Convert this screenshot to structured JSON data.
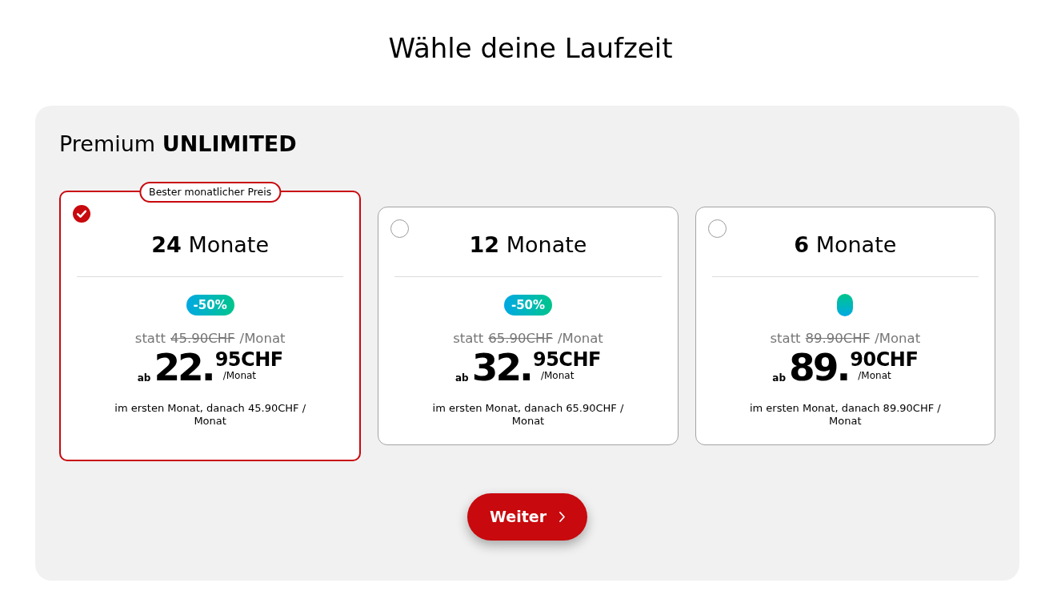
{
  "page": {
    "title": "Wähle deine Laufzeit"
  },
  "product": {
    "name": "Premium **UNLIMITED**"
  },
  "plans": [
    {
      "selected": true,
      "highlight": "Bester monatlicher Preis",
      "title": "**24** Monate",
      "discount_badge": true,
      "discount": "-50%",
      "was_label": "statt",
      "old_price": "45.90CHF",
      "old_price_unit": "/Monat",
      "prefix": "ab",
      "price_whole": "22.",
      "price_fraction": "95CHF",
      "price_unit": "/Monat",
      "note": "im ersten Monat, danach 45.90CHF / Monat"
    },
    {
      "selected": false,
      "title": "**12** Monate",
      "discount_badge": true,
      "discount": "-50%",
      "was_label": "statt",
      "old_price": "65.90CHF",
      "old_price_unit": "/Monat",
      "prefix": "ab",
      "price_whole": "32.",
      "price_fraction": "95CHF",
      "price_unit": "/Monat",
      "note": "im ersten Monat, danach 65.90CHF / Monat"
    },
    {
      "selected": false,
      "title": "**6** Monate",
      "discount_badge": true,
      "was_label": "statt",
      "old_price": "89.90CHF",
      "old_price_unit": "/Monat",
      "prefix": "ab",
      "price_whole": "89.",
      "price_fraction": "90CHF",
      "price_unit": "/Monat",
      "note": "im ersten Monat, danach 89.90CHF / Monat"
    }
  ],
  "continue_button": {
    "label": "Weiter"
  }
}
